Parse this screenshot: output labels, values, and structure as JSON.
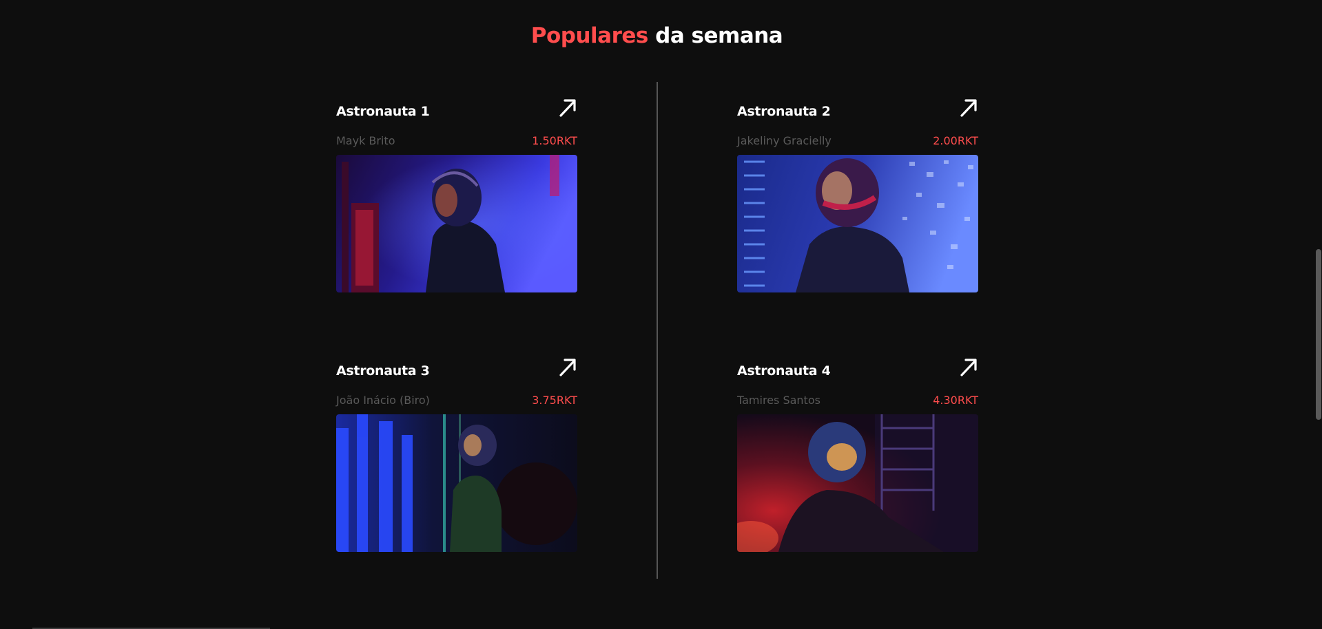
{
  "section": {
    "title_accent": "Populares",
    "title_rest": "da semana"
  },
  "colors": {
    "background": "#0e0e0e",
    "accent": "#ff4d4d",
    "text": "#ffffff",
    "muted": "#5a5a5a"
  },
  "cards": [
    {
      "title": "Astronauta 1",
      "artist": "Mayk Brito",
      "price": "1.50RKT",
      "icon": "arrow-up-right-icon",
      "image": "astronaut-1-image"
    },
    {
      "title": "Astronauta 2",
      "artist": "Jakeliny Gracielly",
      "price": "2.00RKT",
      "icon": "arrow-up-right-icon",
      "image": "astronaut-2-image"
    },
    {
      "title": "Astronauta 3",
      "artist": "João Inácio (Biro)",
      "price": "3.75RKT",
      "icon": "arrow-up-right-icon",
      "image": "astronaut-3-image"
    },
    {
      "title": "Astronauta 4",
      "artist": "Tamires Santos",
      "price": "4.30RKT",
      "icon": "arrow-up-right-icon",
      "image": "astronaut-4-image"
    }
  ]
}
